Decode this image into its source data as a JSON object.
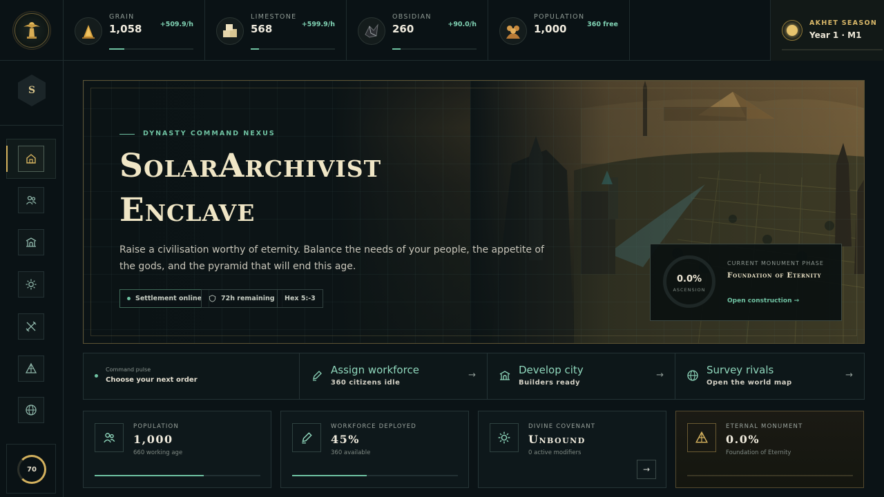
{
  "resources": [
    {
      "name": "GRAIN",
      "value": "1,058",
      "rate": "+509.9/h",
      "icon": "grain-icon",
      "fill": 0.18
    },
    {
      "name": "LIMESTONE",
      "value": "568",
      "rate": "+599.9/h",
      "icon": "limestone-icon",
      "fill": 0.1
    },
    {
      "name": "OBSIDIAN",
      "value": "260",
      "rate": "+90.0/h",
      "icon": "obsidian-icon",
      "fill": 0.1
    },
    {
      "name": "POPULATION",
      "value": "1,000",
      "rate": "360 free",
      "icon": "population-icon"
    }
  ],
  "season": {
    "label": "AKHET SEASON",
    "year": "Year 1 · M1"
  },
  "sidebar": {
    "badge": "S",
    "nav": [
      "home-icon",
      "people-icon",
      "temple-icon",
      "sun-icon",
      "battle-icon",
      "pyramid-icon",
      "globe-icon"
    ],
    "progress": "70"
  },
  "hero": {
    "kicker": "DYNASTY COMMAND NEXUS",
    "title_line1": "SolarArchivist",
    "title_line2": "Enclave",
    "description": "Raise a civilisation worthy of eternity. Balance the needs of your people, the appetite of the gods, and the pyramid that will end this age.",
    "chips": [
      "Settlement online",
      "72h remaining",
      "Hex 5:-3"
    ]
  },
  "monument": {
    "percent": "0.0%",
    "percent_label": "ASCENSION",
    "phase_label": "CURRENT MONUMENT PHASE",
    "phase_title": "Foundation of Eternity",
    "link": "Open construction →"
  },
  "command": {
    "pulse_label": "Command pulse",
    "pulse_text": "Choose your next order",
    "actions": [
      {
        "title": "Assign workforce",
        "sub": "360 citizens idle",
        "icon": "pencil-icon"
      },
      {
        "title": "Develop city",
        "sub": "Builders ready",
        "icon": "temple-icon"
      },
      {
        "title": "Survey rivals",
        "sub": "Open the world map",
        "icon": "globe-icon"
      }
    ],
    "arrow": "→"
  },
  "cards": [
    {
      "label": "POPULATION",
      "value": "1,000",
      "sub": "660 working age",
      "icon": "people-icon",
      "fill": 0.66
    },
    {
      "label": "WORKFORCE DEPLOYED",
      "value": "45%",
      "sub": "360 available",
      "icon": "pencil-icon",
      "fill": 0.45
    },
    {
      "label": "DIVINE COVENANT",
      "value": "Unbound",
      "sub": "0 active modifiers",
      "icon": "sun-icon",
      "button": "→"
    },
    {
      "label": "ETERNAL MONUMENT",
      "value": "0.0%",
      "sub": "Foundation of Eternity",
      "icon": "pyramid-icon",
      "fill": 0.0
    }
  ],
  "colors": {
    "accent": "#6fc2a2",
    "gold": "#d6b35f",
    "background": "#0b1316"
  }
}
